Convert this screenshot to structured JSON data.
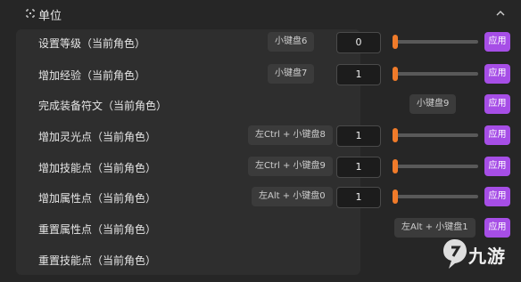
{
  "header": {
    "title": "单位"
  },
  "rows": [
    {
      "label": "设置等级（当前角色）",
      "hotkey": "小键盘6",
      "value": "0",
      "slider": 0.0,
      "apply": "应用"
    },
    {
      "label": "增加经验（当前角色）",
      "hotkey": "小键盘7",
      "value": "1",
      "slider": 0.0,
      "apply": "应用"
    },
    {
      "label": "完成装备符文（当前角色）",
      "hotkey": "小键盘9",
      "apply": "应用"
    },
    {
      "label": "增加灵光点（当前角色）",
      "hotkey": "左Ctrl + 小键盘8",
      "value": "1",
      "slider": 0.0,
      "apply": "应用"
    },
    {
      "label": "增加技能点（当前角色）",
      "hotkey": "左Ctrl + 小键盘9",
      "value": "1",
      "slider": 0.0,
      "apply": "应用"
    },
    {
      "label": "增加属性点（当前角色）",
      "hotkey": "左Alt + 小键盘0",
      "value": "1",
      "slider": 0.0,
      "apply": "应用"
    },
    {
      "label": "重置属性点（当前角色）",
      "hotkey": "左Alt + 小键盘1",
      "apply": "应用"
    },
    {
      "label": "重置技能点（当前角色）"
    }
  ],
  "watermark": {
    "text": "九游"
  },
  "colors": {
    "accent_purple": "#a64ee6",
    "slider_orange": "#f07b2a"
  }
}
